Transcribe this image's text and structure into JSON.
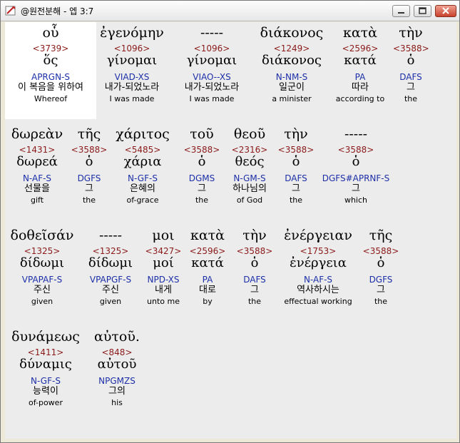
{
  "window": {
    "title": "@원전분해 - 엡 3:7",
    "minimize_label": "minimize",
    "maximize_label": "maximize",
    "close_label": "close"
  },
  "words": [
    {
      "greek": "οὗ",
      "strong": "<3739>",
      "lemma": "ὅς",
      "parse": "APRGN-S",
      "korean": "이 복음을 위하여",
      "english": "Whereof"
    },
    {
      "greek": "ἐγενόμην",
      "strong": "<1096>",
      "lemma": "γίνομαι",
      "parse": "VIAD-XS",
      "korean": "내가-되었노라",
      "english": "I was made"
    },
    {
      "greek": "-----",
      "strong": "<1096>",
      "lemma": "γίνομαι",
      "parse": "VIAO--XS",
      "korean": "내가-되었노라",
      "english": "I was made"
    },
    {
      "greek": "διάκονος",
      "strong": "<1249>",
      "lemma": "διάκονος",
      "parse": "N-NM-S",
      "korean": "일군이",
      "english": "a minister"
    },
    {
      "greek": "κατὰ",
      "strong": "<2596>",
      "lemma": "κατά",
      "parse": "PA",
      "korean": "따라",
      "english": "according to"
    },
    {
      "greek": "τὴν",
      "strong": "<3588>",
      "lemma": "ὁ",
      "parse": "DAFS",
      "korean": "그",
      "english": "the"
    },
    {
      "greek": "δωρεὰν",
      "strong": "<1431>",
      "lemma": "δωρεά",
      "parse": "N-AF-S",
      "korean": "선물을",
      "english": "gift"
    },
    {
      "greek": "τῆς",
      "strong": "<3588>",
      "lemma": "ὁ",
      "parse": "DGFS",
      "korean": "그",
      "english": "the"
    },
    {
      "greek": "χάριτος",
      "strong": "<5485>",
      "lemma": "χάρια",
      "parse": "N-GF-S",
      "korean": "은혜의",
      "english": "of-grace"
    },
    {
      "greek": "τοῦ",
      "strong": "<3588>",
      "lemma": "ὁ",
      "parse": "DGMS",
      "korean": "그",
      "english": "the"
    },
    {
      "greek": "θεοῦ",
      "strong": "<2316>",
      "lemma": "θεός",
      "parse": "N-GM-S",
      "korean": "하나님의",
      "english": "of God"
    },
    {
      "greek": "τὴν",
      "strong": "<3588>",
      "lemma": "ὁ",
      "parse": "DAFS",
      "korean": "그",
      "english": "the"
    },
    {
      "greek": "-----",
      "strong": "<3588>",
      "lemma": "ὁ",
      "parse": "DGFS#APRNF-S",
      "korean": "그",
      "english": "which"
    },
    {
      "greek": "δοθεῖσάν",
      "strong": "<1325>",
      "lemma": "δίδωμι",
      "parse": "VPAPAF-S",
      "korean": "주신",
      "english": "given"
    },
    {
      "greek": "-----",
      "strong": "<1325>",
      "lemma": "δίδωμι",
      "parse": "VPAPGF-S",
      "korean": "주신",
      "english": "given"
    },
    {
      "greek": "μοι",
      "strong": "<3427>",
      "lemma": "μοί",
      "parse": "NPD-XS",
      "korean": "내게",
      "english": "unto me"
    },
    {
      "greek": "κατὰ",
      "strong": "<2596>",
      "lemma": "κατά",
      "parse": "PA",
      "korean": "대로",
      "english": "by"
    },
    {
      "greek": "τὴν",
      "strong": "<3588>",
      "lemma": "ὁ",
      "parse": "DAFS",
      "korean": "그",
      "english": "the"
    },
    {
      "greek": "ἐνέργειαν",
      "strong": "<1753>",
      "lemma": "ἐνέργεια",
      "parse": "N-AF-S",
      "korean": "역사하시는",
      "english": "effectual working"
    },
    {
      "greek": "τῆς",
      "strong": "<3588>",
      "lemma": "ὁ",
      "parse": "DGFS",
      "korean": "그",
      "english": "the"
    },
    {
      "greek": "δυνάμεως",
      "strong": "<1411>",
      "lemma": "δύναμις",
      "parse": "N-GF-S",
      "korean": "능력이",
      "english": "of-power"
    },
    {
      "greek": "αὐτοῦ.",
      "strong": "<848>",
      "lemma": "αὐτοῦ",
      "parse": "NPGMZS",
      "korean": "그의",
      "english": "his"
    }
  ],
  "colors": {
    "strong_number": "#8b1a1a",
    "parsing_code": "#1c2fa8",
    "content_background": "#ececec",
    "selected_cell": "#ffffff"
  }
}
